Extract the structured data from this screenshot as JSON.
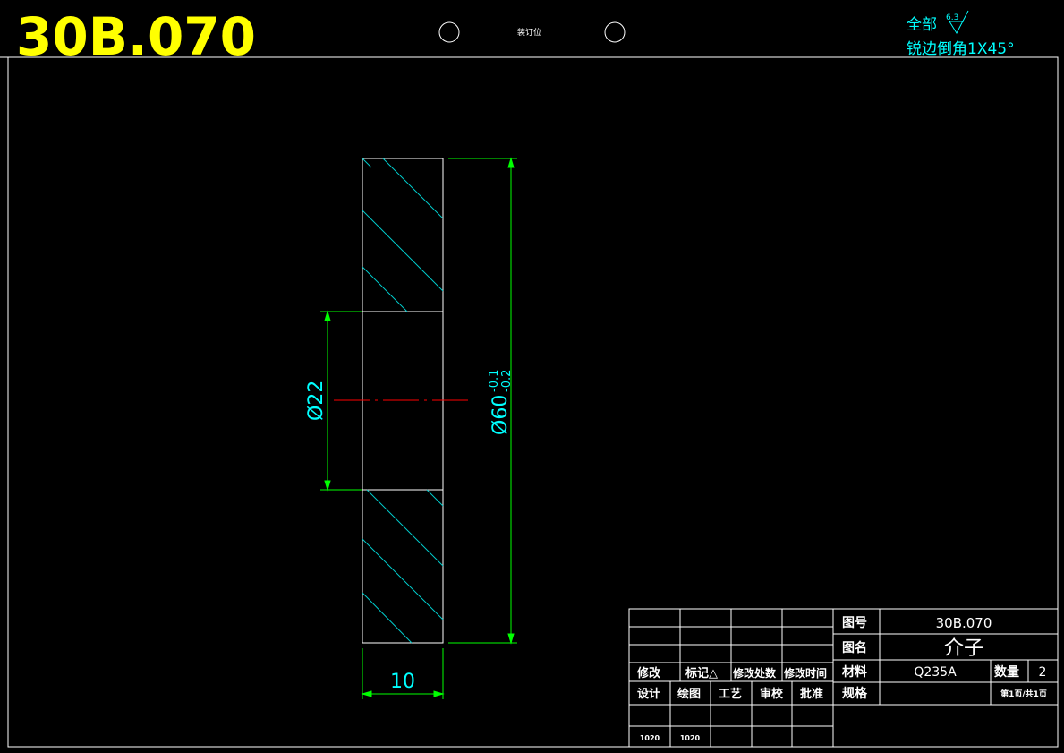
{
  "header": {
    "drawing_code": "30B.070",
    "binding_label": "装订位"
  },
  "notes": {
    "roughness_prefix": "全部",
    "roughness_value": "6.3",
    "chamfer_note": "锐边倒角1X45°"
  },
  "dimensions": {
    "bore": "Ø22",
    "outer_diameter": "Ø60",
    "outer_tol_upper": "-0.1",
    "outer_tol_lower": "-0.2",
    "thickness": "10"
  },
  "title_block": {
    "drawing_no_label": "图号",
    "drawing_no": "30B.070",
    "name_label": "图名",
    "name": "介子",
    "material_label": "材料",
    "material": "Q235A",
    "qty_label": "数量",
    "qty": "2",
    "spec_label": "规格",
    "page": "第1页/共1页",
    "rev_headers": [
      "修改",
      "标记△",
      "修改处数",
      "修改时间"
    ],
    "sign_headers": [
      "设计",
      "绘图",
      "工艺",
      "审校",
      "批准"
    ],
    "sign_dates": [
      "1020",
      "1020",
      "",
      "",
      ""
    ]
  },
  "colors": {
    "border": "#ffffff",
    "title": "#ffff00",
    "cyan": "#00ffff",
    "green": "#00ff00",
    "center": "#ff0000",
    "hatch": "#00cccc"
  }
}
